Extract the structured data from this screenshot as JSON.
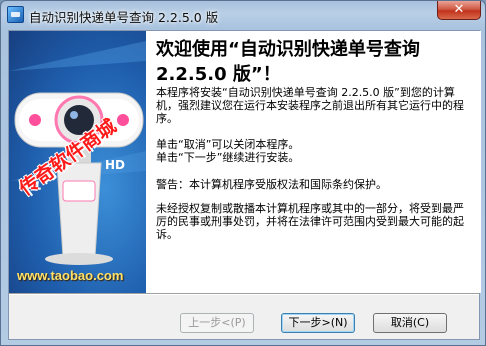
{
  "window": {
    "title": "自动识别快递单号查询 2.2.5.0 版",
    "close_glyph": "✕"
  },
  "side_banner": {
    "promo_text": "传奇软件商城",
    "url": "www.taobao.com",
    "product_label": "HD"
  },
  "content": {
    "heading": "欢迎使用“自动识别快递单号查询 2.2.5.0 版”！",
    "paragraphs": [
      "本程序将安装“自动识别快递单号查询 2.2.5.0 版”到您的计算机，强烈建议您在运行本安装程序之前退出所有其它运行中的程序。",
      "单击“取消”可以关闭本程序。\n单击“下一步”继续进行安装。",
      "警告：本计算机程序受版权法和国际条约保护。",
      "未经授权复制或散播本计算机程序或其中的一部分，将受到最严厉的民事或刑事处罚，并将在法律许可范围内受到最大可能的起诉。"
    ]
  },
  "buttons": {
    "back": "上一步<(P)",
    "next": "下一步>(N)",
    "cancel": "取消(C)"
  },
  "colors": {
    "banner_blue": "#1f5fae",
    "promo_red": "#ff1a1a",
    "url_yellow": "#ffe36a",
    "close_red": "#c1331c"
  },
  "icons": {
    "app": "installer-app-icon",
    "close": "close-icon"
  }
}
